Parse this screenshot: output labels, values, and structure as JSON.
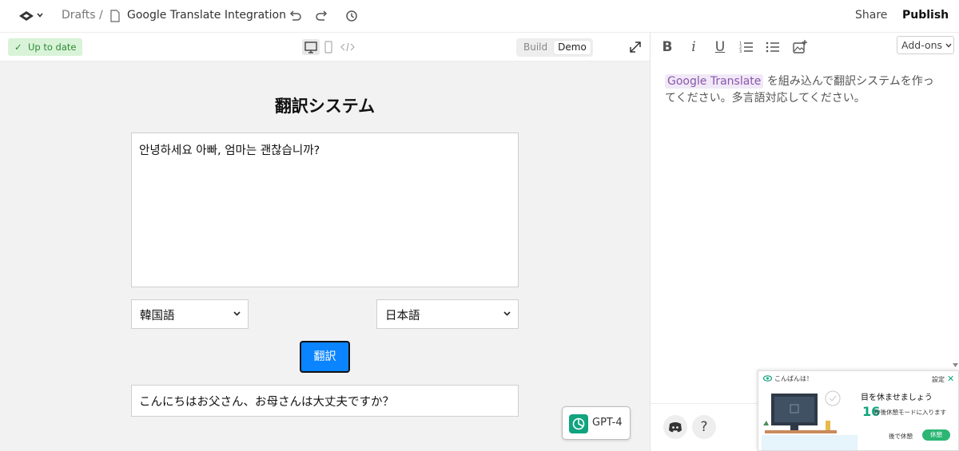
{
  "topbar": {
    "breadcrumb_drafts": "Drafts",
    "breadcrumb_sep": "/",
    "doc_title": "Google Translate Integration",
    "share_label": "Share",
    "publish_label": "Publish"
  },
  "preview_toolbar": {
    "status_badge": "Up to date",
    "build_label": "Build",
    "demo_label": "Demo"
  },
  "app": {
    "title": "翻訳システム",
    "source_text": "안녕하세요 아빠, 엄마는 괜찮습니까?",
    "source_language": "韓国語",
    "target_language": "日本語",
    "translate_button": "翻訳",
    "result_text": "こんにちはお父さん、お母さんは大丈夫ですか？"
  },
  "gpt_button": {
    "label": "GPT-4"
  },
  "editor": {
    "addons_label": "Add-ons",
    "prompt_tag": "Google Translate",
    "prompt_text": " を組み込んで翻訳システムを作ってください。多言語対応してください。"
  },
  "notification": {
    "header": "こんばんは！",
    "settings": "設定",
    "close": "✕",
    "message_title": "目を休ませましょう",
    "countdown_number": "16",
    "countdown_text": "秒後休憩モードに入ります",
    "later_label": "後で休憩",
    "rest_label": "休憩"
  },
  "colors": {
    "accent_blue": "#0a84ff",
    "status_green": "#2f8a33",
    "gpt_green": "#10a37f",
    "tag_purple": "#8a56ac"
  }
}
